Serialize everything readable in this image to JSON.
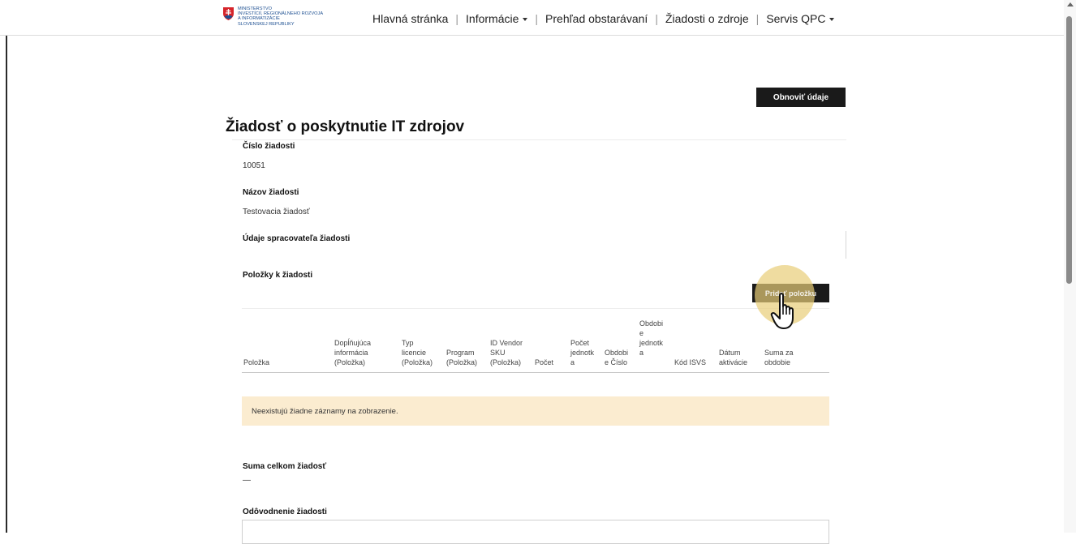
{
  "brand": {
    "logo_lines": [
      "MINISTERSTVO",
      "INVESTÍCIÍ, REGIONÁLNEHO ROZVOJA",
      "A INFORMATIZÁCIE",
      "SLOVENSKEJ REPUBLIKY"
    ]
  },
  "nav": {
    "home": "Hlavná stránka",
    "info": "Informácie",
    "procurement": "Prehľad obstarávaní",
    "requests": "Žiadosti o zdroje",
    "servis": "Servis QPC"
  },
  "actions": {
    "refresh": "Obnoviť údaje",
    "add_item": "Pridať položku"
  },
  "page": {
    "title": "Žiadosť o poskytnutie IT zdrojov"
  },
  "fields": {
    "request_number_label": "Číslo žiadosti",
    "request_number_value": "10051",
    "request_name_label": "Názov žiadosti",
    "request_name_value": "Testovacia žiadosť",
    "processor_label": "Údaje spracovateľa žiadosti",
    "items_label": "Položky k žiadosti",
    "total_label": "Suma celkom žiadosť",
    "total_value": "—",
    "justification_label": "Odôvodnenie žiadosti"
  },
  "table": {
    "columns": [
      "Položka",
      "Dopĺňujúca informácia (Položka)",
      "Typ licencie (Položka)",
      "Program (Položka)",
      "ID Vendor SKU (Položka)",
      "Počet",
      "Počet jednotka",
      "Obdobie Číslo",
      "Obdobie jednotka",
      "Kód ISVS",
      "Dátum aktivácie",
      "Suma za obdobie"
    ],
    "column_display": [
      [
        "",
        "",
        "",
        "Položka"
      ],
      [
        "",
        "Dopĺňujúca",
        "informácia",
        "(Položka)"
      ],
      [
        "",
        "Typ",
        "licencie",
        "(Položka)"
      ],
      [
        "",
        "",
        "Program",
        "(Položka)"
      ],
      [
        "",
        "ID Vendor",
        "SKU",
        "(Položka)"
      ],
      [
        "",
        "",
        "",
        "Počet"
      ],
      [
        "",
        "Počet",
        "jednotk",
        "a"
      ],
      [
        "",
        "",
        "Obdobi",
        "e Číslo"
      ],
      [
        "Obdobi",
        "e",
        "jednotk",
        "a"
      ],
      [
        "",
        "",
        "",
        "Kód ISVS"
      ],
      [
        "",
        "",
        "Dátum",
        "aktivácie"
      ],
      [
        "",
        "",
        "Suma za",
        "obdobie"
      ]
    ],
    "empty_message": "Neexistujú žiadne záznamy na zobrazenie."
  },
  "icons": {
    "logo": "slovak-coat-of-arms-icon",
    "cursor": "hand-pointer-icon",
    "dropdown": "caret-down-icon"
  },
  "colors": {
    "button_bg": "#1a1a1a",
    "empty_row_bg": "#fbecd0",
    "highlight": "#e8cd78",
    "logo_blue": "#1d4f91",
    "logo_red": "#d6252b"
  }
}
